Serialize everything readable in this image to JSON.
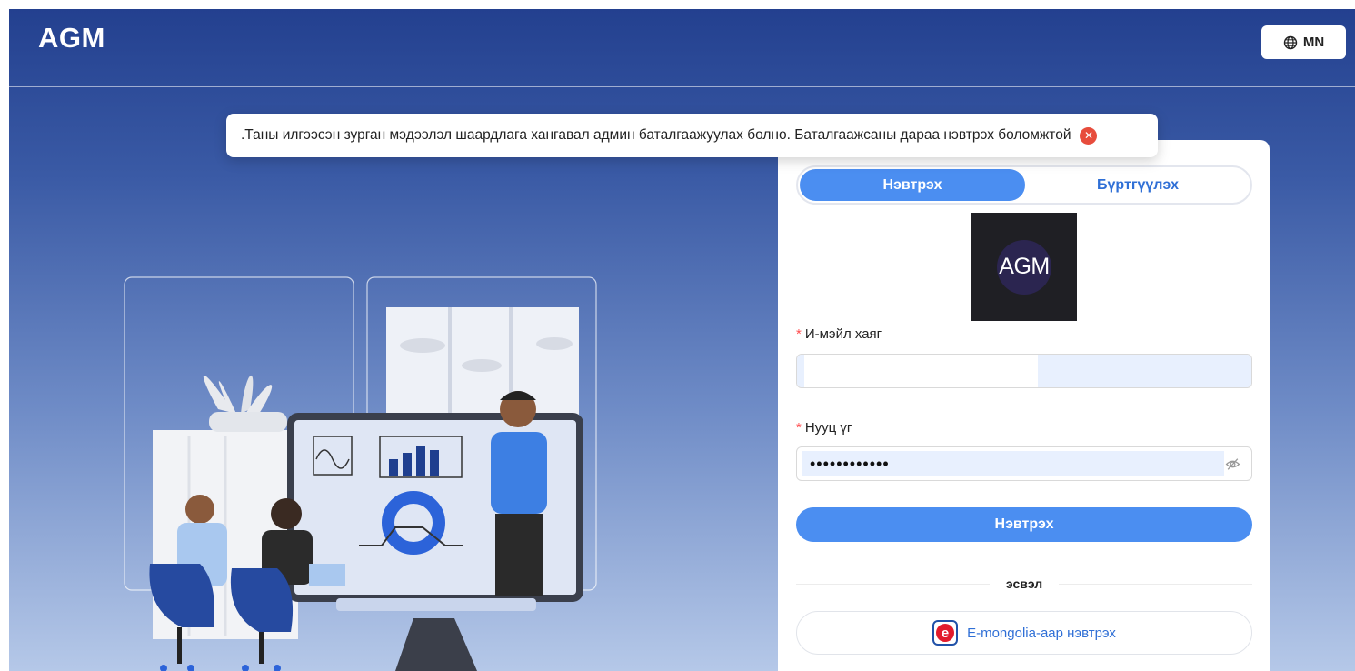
{
  "header": {
    "brand": "AGM",
    "language_label": "MN",
    "language_icon": "globe-icon"
  },
  "toast": {
    "message": ".Таны илгээсэн зурган мэдээлэл шаардлага хангавал админ баталгаажуулах болно. Баталгаажсаны дараа нэвтрэх боломжтой",
    "close_icon": "close-circle-icon",
    "color": "#e74c3c"
  },
  "auth": {
    "tabs": [
      {
        "label": "Нэвтрэх",
        "active": true
      },
      {
        "label": "Бүртгүүлэх",
        "active": false
      }
    ],
    "logo_text": "AGM",
    "email": {
      "label": "И-мэйл хаяг",
      "required_mark": "*",
      "value": ""
    },
    "password": {
      "label": "Нууц үг",
      "required_mark": "*",
      "value": "••••••••••••",
      "toggle_icon": "eye-off-icon"
    },
    "submit_label": "Нэвтрэх",
    "or_label": "эсвэл",
    "emongolia_label": "E-mongolia-aap нэвтрэх",
    "emongolia_logo_letter": "e"
  },
  "colors": {
    "primary": "#4b8ef1",
    "header_bg": "#23408f",
    "required": "#ff4d4f"
  }
}
